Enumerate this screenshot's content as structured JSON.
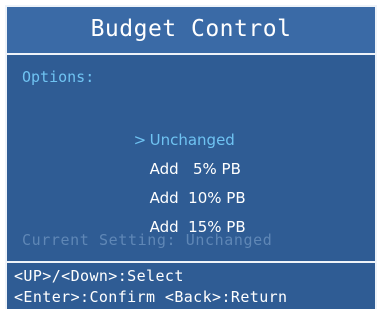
{
  "window": {
    "title": "Budget Control"
  },
  "options": {
    "heading": "Options:",
    "cursor_glyph": ">",
    "selected_index": 0,
    "items": [
      {
        "label": "Unchanged"
      },
      {
        "label": "Add   5% PB"
      },
      {
        "label": "Add  10% PB"
      },
      {
        "label": "Add  15% PB"
      }
    ]
  },
  "status": {
    "current_setting": "Current Setting: Unchanged"
  },
  "help": {
    "line1": "<UP>/<Down>:Select",
    "line2": "<Enter>:Confirm <Back>:Return"
  },
  "colors": {
    "background": "#2f5c94",
    "title_bar": "#3a6aa6",
    "accent": "#6fc3f2",
    "dim_text": "#5f87b6",
    "border": "#eef3f9"
  }
}
